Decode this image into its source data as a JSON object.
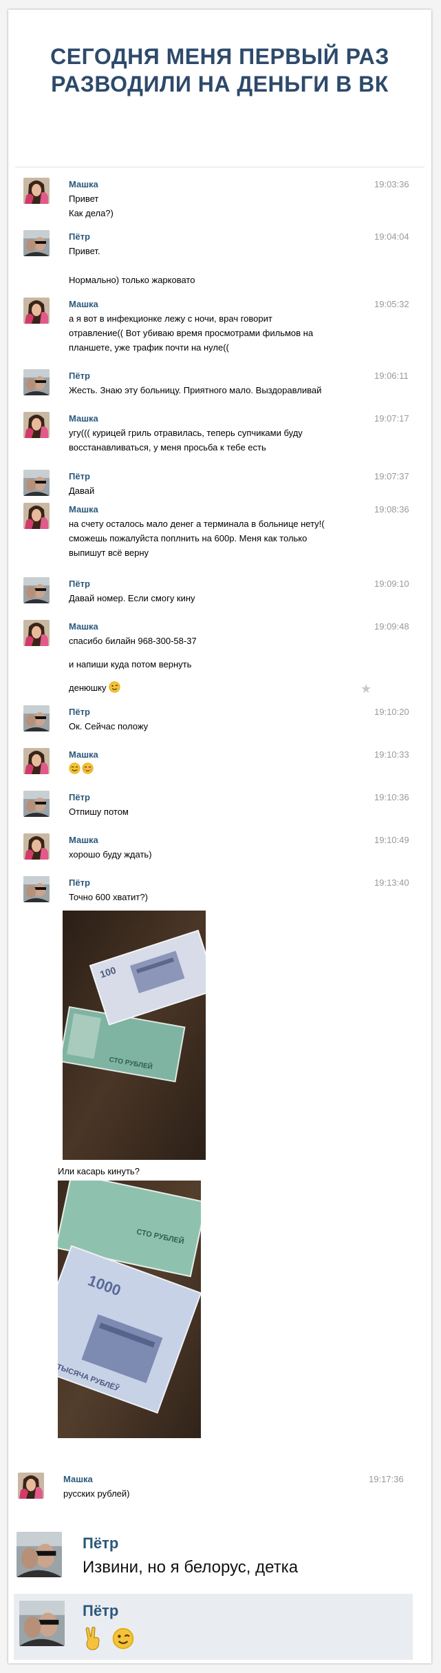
{
  "title": {
    "line1": "СЕГОДНЯ МЕНЯ ПЕРВЫЙ РАЗ",
    "line2": "РАЗВОДИЛИ НА ДЕНЬГИ В ВК"
  },
  "users": {
    "masha": "Машка",
    "petr": "Пётр"
  },
  "colors": {
    "name": "#2b587a",
    "time": "#999999",
    "title": "#2d4a6b",
    "highlight": "#e9edf1"
  },
  "messages": [
    {
      "user": "Машка",
      "time": "19:03:36",
      "lines": [
        "Привет",
        "Как дела?)"
      ]
    },
    {
      "user": "Пётр",
      "time": "19:04:04",
      "lines": [
        "Привет.",
        "",
        "Нормально) только жарковато"
      ]
    },
    {
      "user": "Машка",
      "time": "19:05:32",
      "lines": [
        "а я вот в инфекционке лежу с ночи, врач говорит",
        "отравление(( Вот убиваю время просмотрами фильмов на",
        "планшете, уже трафик почти на нуле(("
      ]
    },
    {
      "user": "Пётр",
      "time": "19:06:11",
      "lines": [
        "Жесть. Знаю эту больницу. Приятного мало. Выздоравливай"
      ]
    },
    {
      "user": "Машка",
      "time": "19:07:17",
      "lines": [
        "угу((( курицей гриль отравилась, теперь супчиками буду",
        "восстанавливаться, у меня просьба к тебе есть"
      ]
    },
    {
      "user": "Пётр",
      "time": "19:07:37",
      "lines": [
        "Давай"
      ]
    },
    {
      "user": "Машка",
      "time": "19:08:36",
      "lines": [
        "на счету осталось мало денег а терминала в больнице нету!(",
        "сможешь пожалуйста поплнить на 600р. Меня как только",
        "выпишут всё верну"
      ]
    },
    {
      "user": "Пётр",
      "time": "19:09:10",
      "lines": [
        "Давай номер. Если смогу кину"
      ]
    },
    {
      "user": "Машка",
      "time": "19:09:48",
      "lines": [
        "спасибо билайн 968-300-58-37",
        "",
        "и напиши куда потом вернуть",
        "",
        "денюшку"
      ]
    },
    {
      "user": "Пётр",
      "time": "19:10:20",
      "lines": [
        "Ок. Сейчас положу"
      ]
    },
    {
      "user": "Машка",
      "time": "19:10:33",
      "lines": [
        ""
      ]
    },
    {
      "user": "Пётр",
      "time": "19:10:36",
      "lines": [
        "Отпишу потом"
      ]
    },
    {
      "user": "Машка",
      "time": "19:10:49",
      "lines": [
        "хорошо буду ждать)"
      ]
    },
    {
      "user": "Пётр",
      "time": "19:13:40",
      "lines": [
        "Точно 600 хватит?)"
      ]
    },
    {
      "user": "Машка",
      "time": "19:17:36",
      "lines": [
        "русских рублей)"
      ]
    }
  ],
  "photo_caption": "Или касарь кинуть?",
  "banknotes": {
    "n100": "СТО РУБЛЕЙ",
    "n1000": "ТЫСЯЧА РУБЛЁЎ",
    "value1": "100",
    "value2": "1000"
  },
  "final": [
    {
      "user": "Пётр",
      "text": "Извини, но я белорус, детка"
    },
    {
      "user": "Пётр",
      "text": ""
    }
  ],
  "icons": [
    "wink-emoji",
    "smile-emoji",
    "blush-emoji",
    "victory-hand-emoji",
    "star-icon"
  ]
}
